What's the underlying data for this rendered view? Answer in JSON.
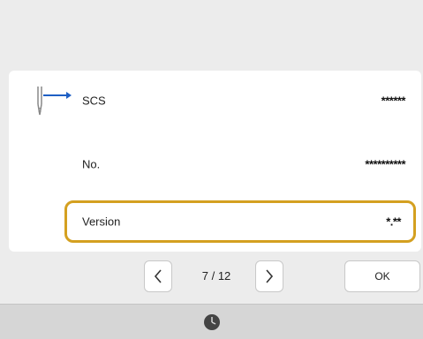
{
  "info_rows": [
    {
      "label": "SCS",
      "value": "******"
    },
    {
      "label": "No.",
      "value": "**********"
    },
    {
      "label": "Version",
      "value": "*.**"
    }
  ],
  "pagination": {
    "current": "7",
    "separator": "/",
    "total": "12"
  },
  "buttons": {
    "ok_label": "OK"
  },
  "colors": {
    "accent": "#d4a020",
    "arrow": "#1e5fc4"
  },
  "icons": {
    "needle": "needle-arrow-icon",
    "prev": "chevron-left-icon",
    "next": "chevron-right-icon",
    "status": "clock-icon"
  }
}
